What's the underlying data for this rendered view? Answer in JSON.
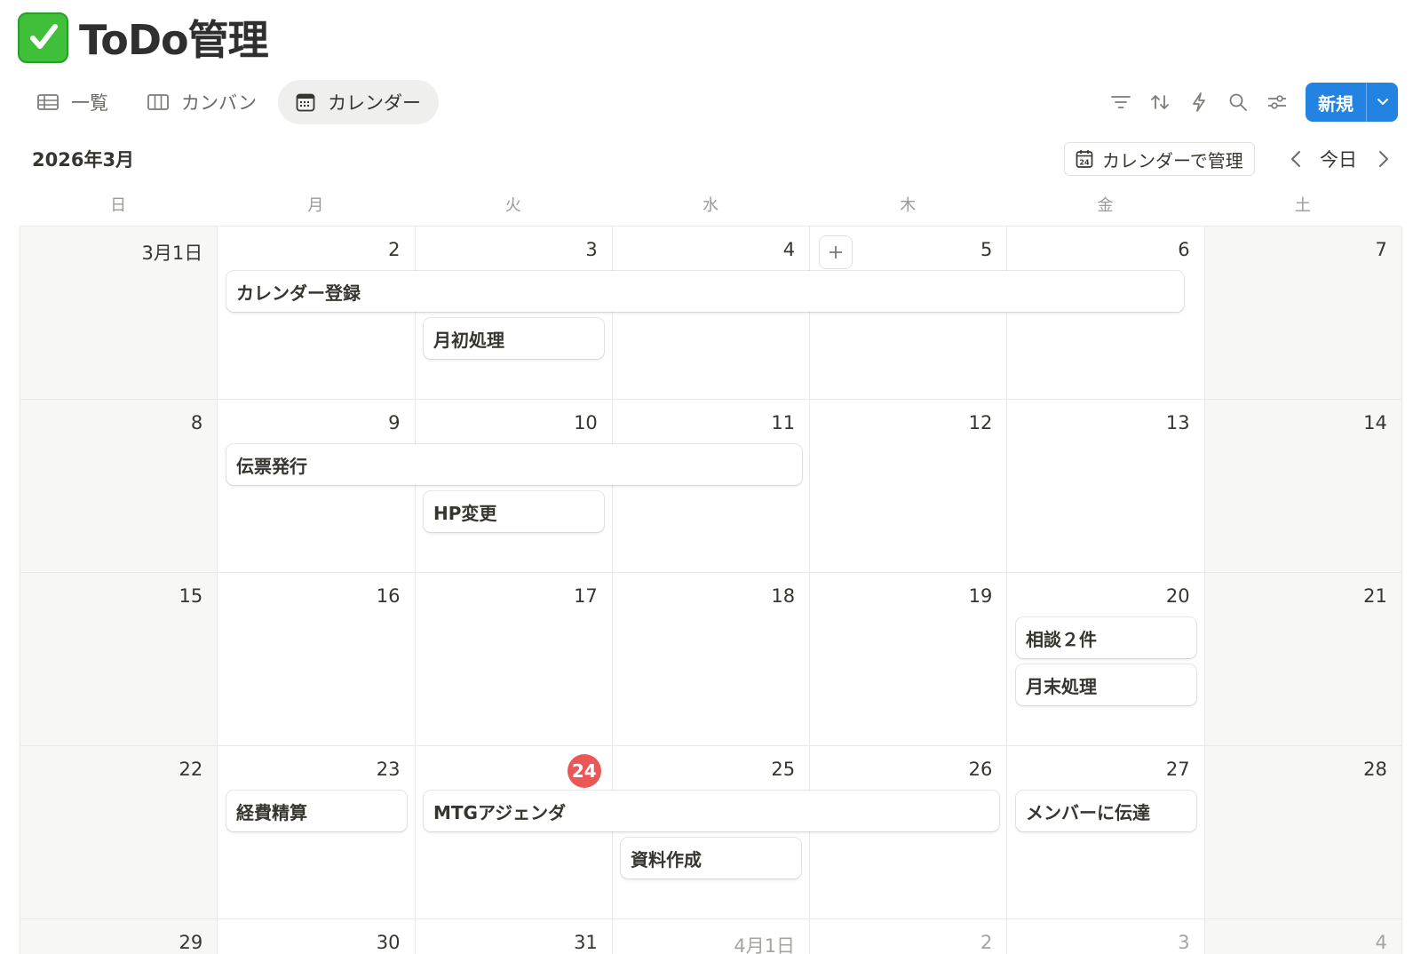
{
  "page": {
    "title": "ToDo管理",
    "title_icon": "check-mark-button-icon"
  },
  "views": [
    {
      "label": "一覧",
      "icon": "table-icon",
      "active": false
    },
    {
      "label": "カンバン",
      "icon": "board-icon",
      "active": false
    },
    {
      "label": "カレンダー",
      "icon": "calendar-icon",
      "active": true
    }
  ],
  "toolbar": {
    "icons": [
      "filter-icon",
      "sort-icon",
      "automation-icon",
      "search-icon",
      "settings-icon"
    ],
    "new_label": "新規"
  },
  "calendar": {
    "month_label": "2026年3月",
    "manage_button": "カレンダーで管理",
    "today_label": "今日",
    "weekdays": [
      "日",
      "月",
      "火",
      "水",
      "木",
      "金",
      "土"
    ],
    "today_date": "24",
    "weeks": [
      [
        "3月1日",
        "2",
        "3",
        "4",
        "5",
        "6",
        "7"
      ],
      [
        "8",
        "9",
        "10",
        "11",
        "12",
        "13",
        "14"
      ],
      [
        "15",
        "16",
        "17",
        "18",
        "19",
        "20",
        "21"
      ],
      [
        "22",
        "23",
        "24",
        "25",
        "26",
        "27",
        "28"
      ],
      [
        "29",
        "30",
        "31",
        "4月1日",
        "2",
        "3",
        "4"
      ]
    ],
    "events": {
      "calendar_registration": "カレンダー登録",
      "month_start": "月初処理",
      "voucher_issue": "伝票発行",
      "hp_change": "HP変更",
      "consult": "相談２件",
      "month_end": "月末処理",
      "expense": "経費精算",
      "mtg_agenda": "MTGアジェンダ",
      "member_notice": "メンバーに伝達",
      "document": "資料作成"
    }
  },
  "colors": {
    "accent": "#2383e2",
    "today": "#eb5757",
    "check": "#3fbf3a"
  }
}
